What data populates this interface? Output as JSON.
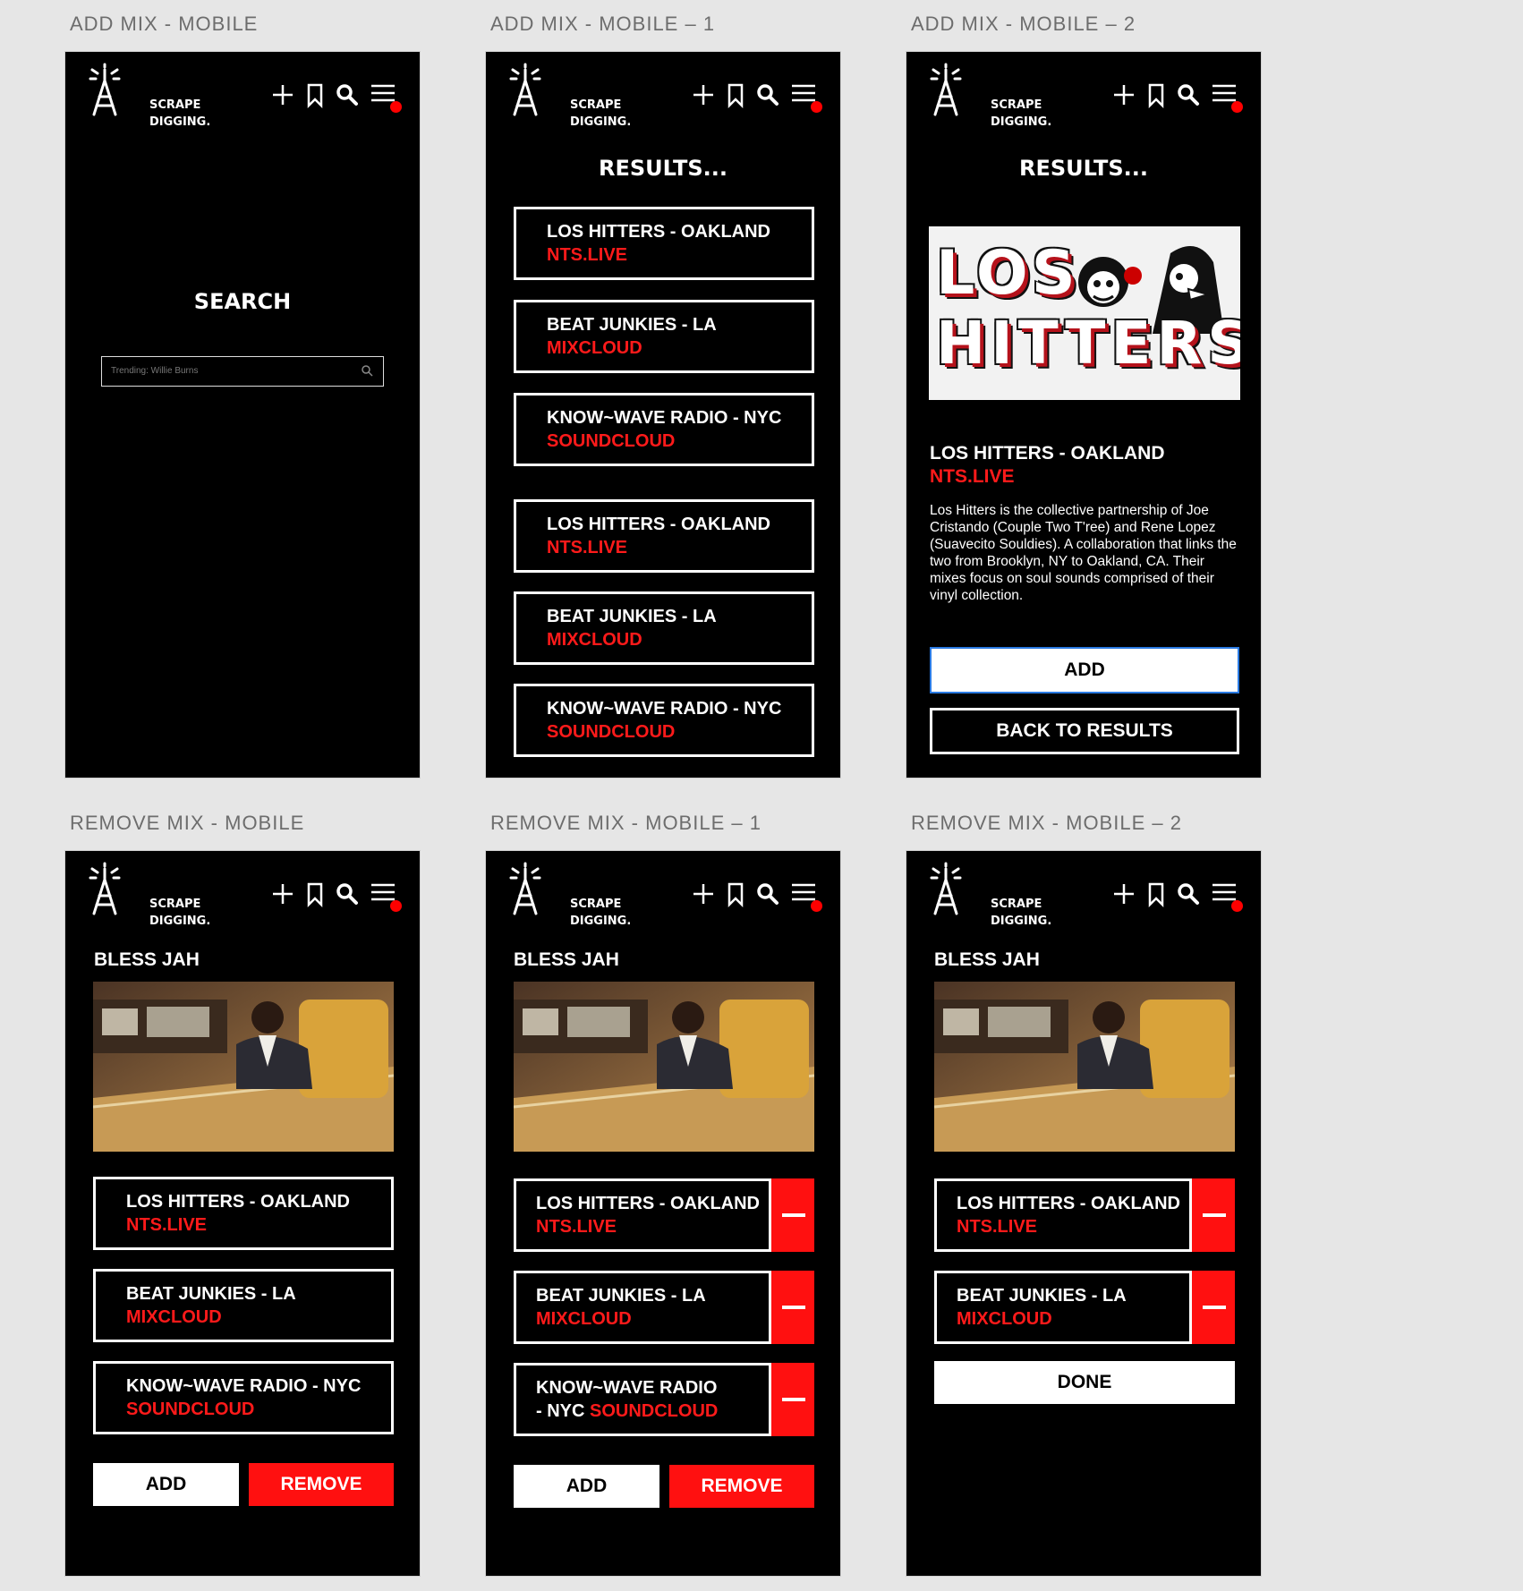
{
  "brand": {
    "line1": "SCRAPE",
    "line2": "DIGGING."
  },
  "colors": {
    "accent": "#ff1010",
    "background": "#000000",
    "focus": "#2a7ae2"
  },
  "header_icons": [
    "plus-icon",
    "bookmark-icon",
    "search-icon",
    "menu-icon"
  ],
  "artboards": [
    "ADD MIX - MOBILE",
    "ADD MIX - MOBILE – 1",
    "ADD MIX - MOBILE – 2",
    "REMOVE MIX - MOBILE",
    "REMOVE MIX - MOBILE – 1",
    "REMOVE MIX - MOBILE – 2"
  ],
  "search": {
    "title": "SEARCH",
    "placeholder": "Trending: Willie Burns"
  },
  "results": {
    "title": "RESULTS...",
    "items": [
      {
        "name": "LOS HITTERS - OAKLAND",
        "source": "NTS.LIVE"
      },
      {
        "name": "BEAT JUNKIES - LA",
        "source": "MIXCLOUD"
      },
      {
        "name": "KNOW~WAVE RADIO - NYC",
        "source": "SOUNDCLOUD"
      },
      {
        "name": "LOS HITTERS - OAKLAND",
        "source": "NTS.LIVE"
      },
      {
        "name": "BEAT JUNKIES - LA",
        "source": "MIXCLOUD"
      },
      {
        "name": "KNOW~WAVE RADIO - NYC",
        "source": "SOUNDCLOUD"
      }
    ]
  },
  "detail": {
    "title": "RESULTS...",
    "logo_line1": "LOS",
    "logo_line2": "HITTERS",
    "name": "LOS HITTERS - OAKLAND",
    "source": "NTS.LIVE",
    "description": "Los Hitters is the collective partnership of Joe Cristando (Couple Two T'ree) and Rene Lopez (Suavecito Souldies). A collaboration that links the two from Brooklyn, NY to Oakland, CA. Their mixes focus on soul sounds comprised of their vinyl collection.",
    "add_label": "ADD",
    "back_label": "BACK TO RESULTS"
  },
  "collection": {
    "title": "BLESS JAH",
    "mixes": [
      {
        "name": "LOS HITTERS - OAKLAND",
        "source": "NTS.LIVE"
      },
      {
        "name": "BEAT JUNKIES - LA",
        "source": "MIXCLOUD"
      },
      {
        "name": "KNOW~WAVE RADIO - NYC",
        "source": "SOUNDCLOUD"
      }
    ],
    "wrapped_line1": "KNOW~WAVE RADIO",
    "wrapped_line2": "- NYC",
    "add_label": "ADD",
    "remove_label": "REMOVE",
    "done_label": "DONE"
  }
}
